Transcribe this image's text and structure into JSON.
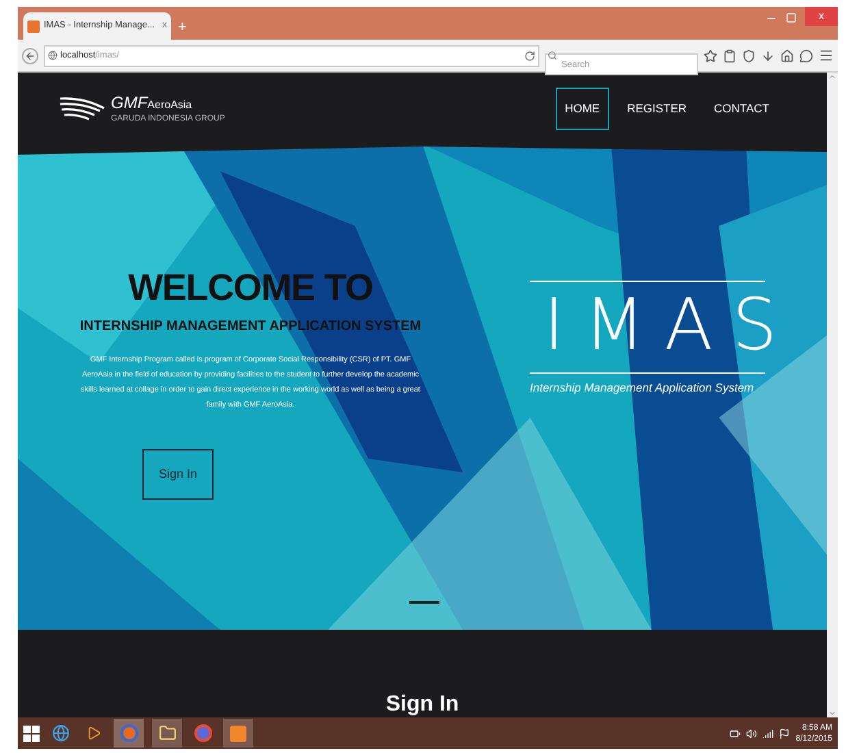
{
  "browser": {
    "tab_title": "IMAS - Internship Manage...",
    "tab_close": "x",
    "new_tab": "+",
    "window_close": "x",
    "url_host": "localhost",
    "url_path": "/imas/",
    "search": {
      "placeholder": "Search"
    }
  },
  "navbar": {
    "logo_name": "GMF",
    "logo_suffix": "AeroAsia",
    "logo_tagline": "GARUDA INDONESIA GROUP",
    "items": [
      {
        "label": "HOME",
        "selected": true
      },
      {
        "label": "REGISTER",
        "selected": false
      },
      {
        "label": "CONTACT",
        "selected": false
      }
    ]
  },
  "hero": {
    "kind": "picture",
    "title": "WELCOME TO",
    "subtitle": "INTERNSHIP MANAGEMENT APPLICATION SYSTEM",
    "description": "GMF Internship Program called is program of Corporate Social Responsibility (CSR) of PT. GMF AeroAsia in the field of education by providing facilities to the student to further develop the academic skills learned at collage in order to gain direct experience in the working world as well as being a great family with GMF AeroAsia.",
    "button": "Sign In",
    "brand": "IMAS",
    "brand_caption": "Internship Management Application System"
  },
  "section": {
    "heading": "Sign In"
  },
  "taskbar": {
    "time": "8:58 AM",
    "date": "8/12/2015"
  }
}
